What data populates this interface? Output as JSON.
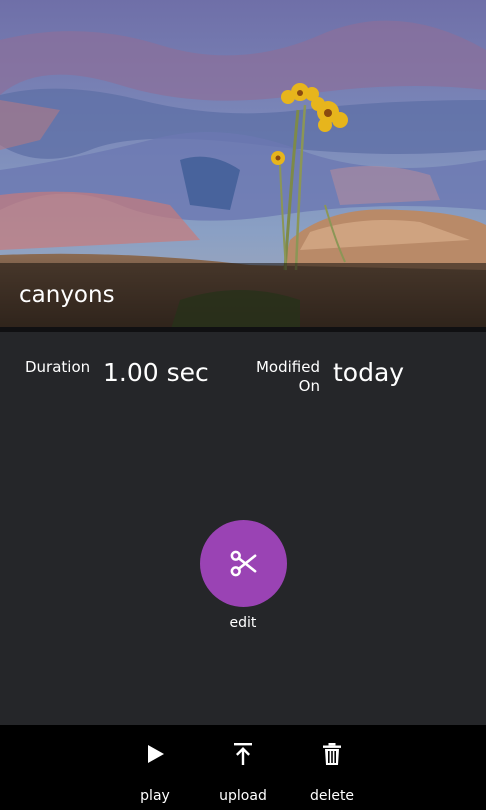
{
  "video": {
    "title": "canyons"
  },
  "details": {
    "duration_label": "Duration",
    "duration_value": "1.00 sec",
    "modified_label_line1": "Modified",
    "modified_label_line2": "On",
    "modified_value": "today"
  },
  "actions": {
    "edit_label": "edit"
  },
  "command_bar": {
    "play_label": "play",
    "upload_label": "upload",
    "delete_label": "delete"
  },
  "colors": {
    "background": "#252629",
    "accent": "#9a43b4",
    "command_bar": "#000000"
  }
}
